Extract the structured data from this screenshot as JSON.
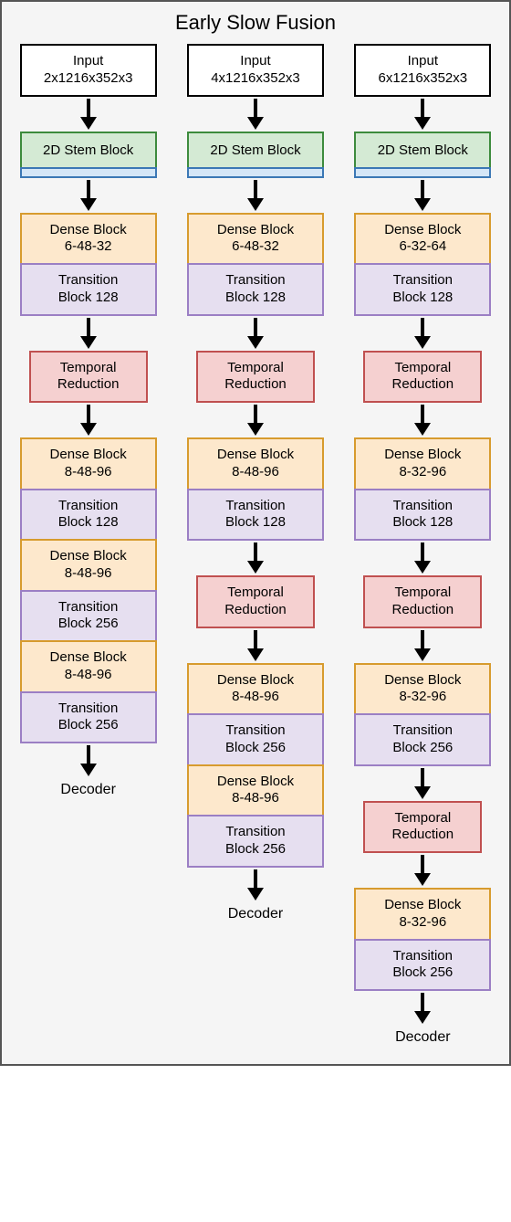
{
  "title": "Early Slow Fusion",
  "columns": [
    {
      "input": {
        "line1": "Input",
        "line2": "2x1216x352x3"
      },
      "stem": "2D Stem Block",
      "blocks": [
        {
          "type": "dense",
          "line1": "Dense Block",
          "line2": "6-48-32"
        },
        {
          "type": "trans",
          "line1": "Transition",
          "line2": "Block 128"
        },
        {
          "type": "arrow"
        },
        {
          "type": "temporal",
          "line1": "Temporal",
          "line2": "Reduction"
        },
        {
          "type": "arrow"
        },
        {
          "type": "dense",
          "line1": "Dense Block",
          "line2": "8-48-96"
        },
        {
          "type": "trans",
          "line1": "Transition",
          "line2": "Block 128"
        },
        {
          "type": "dense",
          "line1": "Dense Block",
          "line2": "8-48-96"
        },
        {
          "type": "trans",
          "line1": "Transition",
          "line2": "Block 256"
        },
        {
          "type": "dense",
          "line1": "Dense Block",
          "line2": "8-48-96"
        },
        {
          "type": "trans",
          "line1": "Transition",
          "line2": "Block 256"
        },
        {
          "type": "arrow"
        }
      ],
      "decoder": "Decoder"
    },
    {
      "input": {
        "line1": "Input",
        "line2": "4x1216x352x3"
      },
      "stem": "2D Stem Block",
      "blocks": [
        {
          "type": "dense",
          "line1": "Dense Block",
          "line2": "6-48-32"
        },
        {
          "type": "trans",
          "line1": "Transition",
          "line2": "Block 128"
        },
        {
          "type": "arrow"
        },
        {
          "type": "temporal",
          "line1": "Temporal",
          "line2": "Reduction"
        },
        {
          "type": "arrow"
        },
        {
          "type": "dense",
          "line1": "Dense Block",
          "line2": "8-48-96"
        },
        {
          "type": "trans",
          "line1": "Transition",
          "line2": "Block 128"
        },
        {
          "type": "arrow"
        },
        {
          "type": "temporal",
          "line1": "Temporal",
          "line2": "Reduction"
        },
        {
          "type": "arrow"
        },
        {
          "type": "dense",
          "line1": "Dense Block",
          "line2": "8-48-96"
        },
        {
          "type": "trans",
          "line1": "Transition",
          "line2": "Block 256"
        },
        {
          "type": "dense",
          "line1": "Dense Block",
          "line2": "8-48-96"
        },
        {
          "type": "trans",
          "line1": "Transition",
          "line2": "Block 256"
        },
        {
          "type": "arrow"
        }
      ],
      "decoder": "Decoder"
    },
    {
      "input": {
        "line1": "Input",
        "line2": "6x1216x352x3"
      },
      "stem": "2D Stem Block",
      "blocks": [
        {
          "type": "dense",
          "line1": "Dense Block",
          "line2": "6-32-64"
        },
        {
          "type": "trans",
          "line1": "Transition",
          "line2": "Block 128"
        },
        {
          "type": "arrow"
        },
        {
          "type": "temporal",
          "line1": "Temporal",
          "line2": "Reduction"
        },
        {
          "type": "arrow"
        },
        {
          "type": "dense",
          "line1": "Dense Block",
          "line2": "8-32-96"
        },
        {
          "type": "trans",
          "line1": "Transition",
          "line2": "Block 128"
        },
        {
          "type": "arrow"
        },
        {
          "type": "temporal",
          "line1": "Temporal",
          "line2": "Reduction"
        },
        {
          "type": "arrow"
        },
        {
          "type": "dense",
          "line1": "Dense Block",
          "line2": "8-32-96"
        },
        {
          "type": "trans",
          "line1": "Transition",
          "line2": "Block 256"
        },
        {
          "type": "arrow"
        },
        {
          "type": "temporal",
          "line1": "Temporal",
          "line2": "Reduction"
        },
        {
          "type": "arrow"
        },
        {
          "type": "dense",
          "line1": "Dense Block",
          "line2": "8-32-96"
        },
        {
          "type": "trans",
          "line1": "Transition",
          "line2": "Block 256"
        },
        {
          "type": "arrow"
        }
      ],
      "decoder": "Decoder"
    }
  ]
}
